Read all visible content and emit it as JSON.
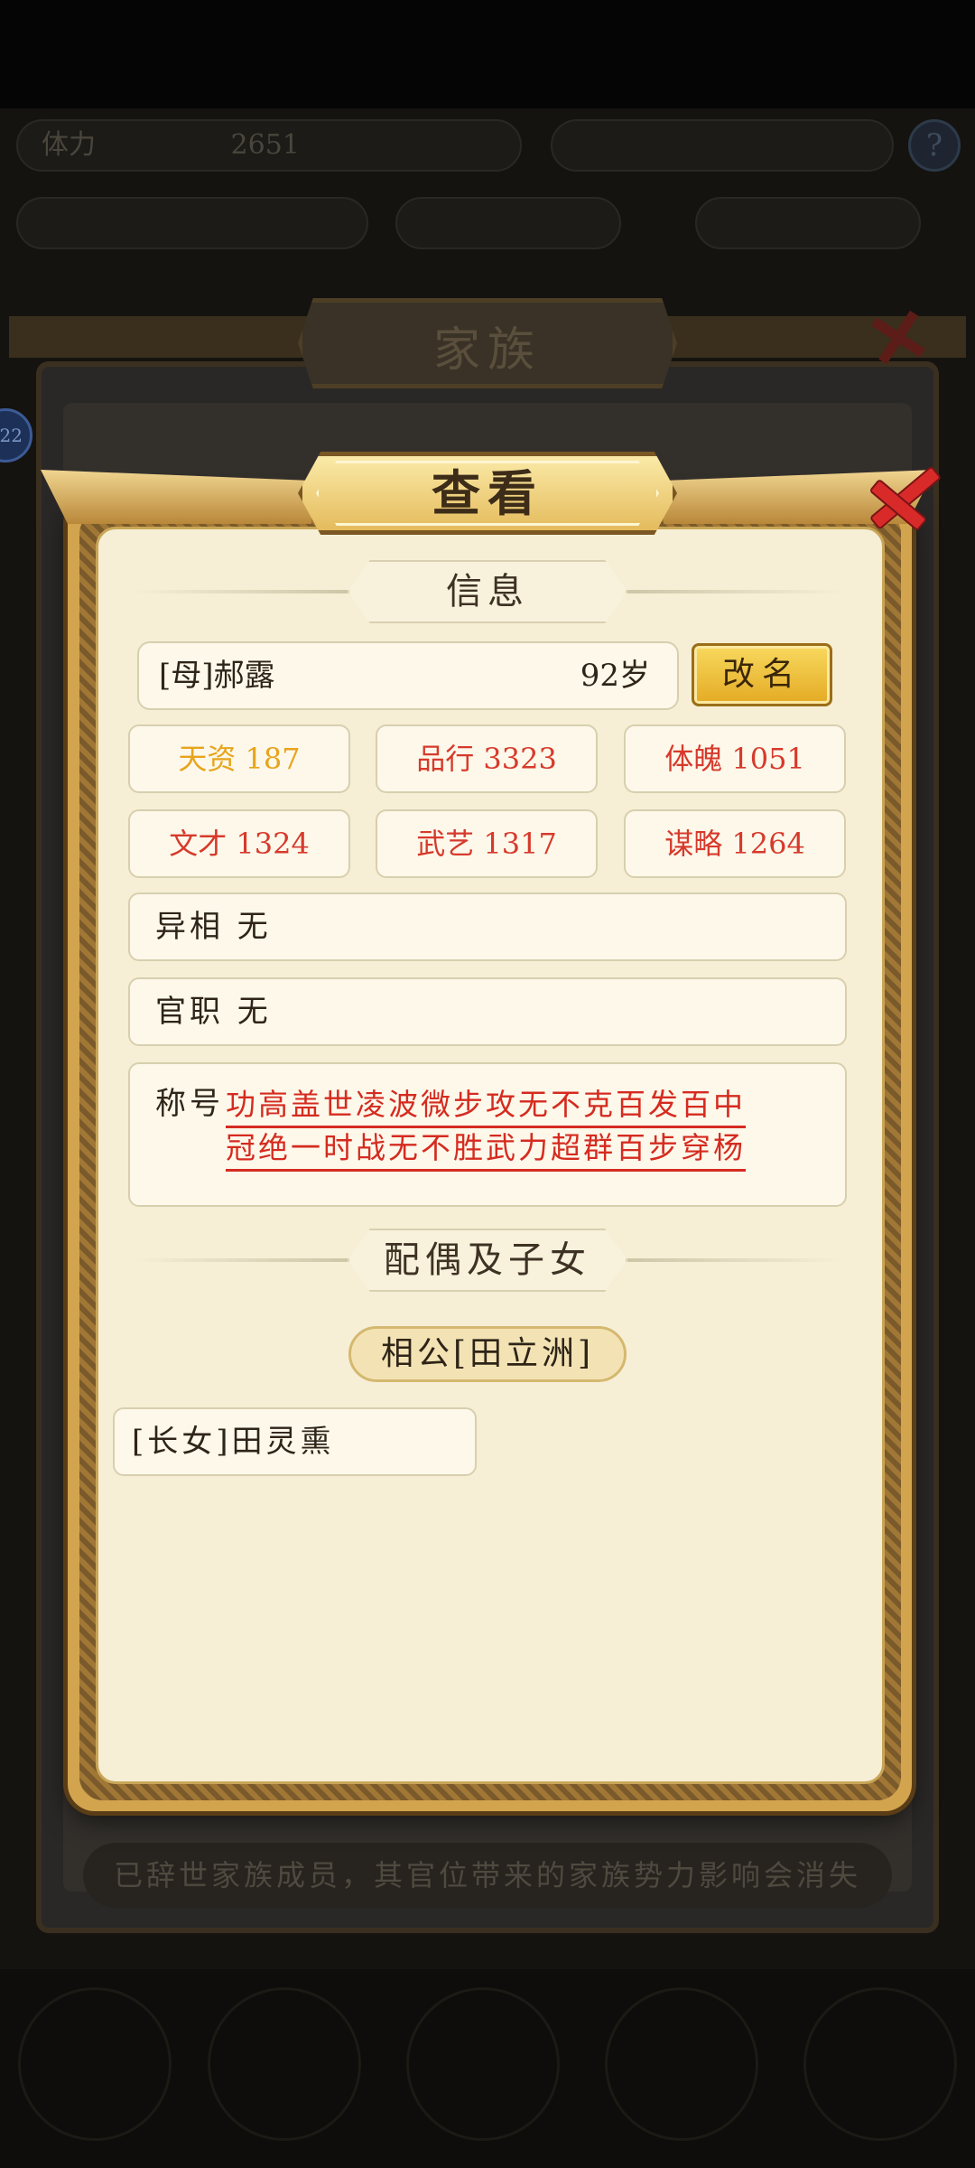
{
  "background": {
    "resources": [
      "体力",
      "2651",
      "",
      "",
      ""
    ],
    "family_panel_title": "家族",
    "footer_note": "已辞世家族成员，其官位带来的家族势力影响会消失",
    "level_badge": "22",
    "help_icon": "question-icon"
  },
  "dialog": {
    "title": "查看",
    "info_header": "信息",
    "name": "[母]郝露",
    "age": "92岁",
    "rename_button": "改名",
    "stats": [
      {
        "label": "天资 187",
        "color": "gold"
      },
      {
        "label": "品行 3323",
        "color": "red"
      },
      {
        "label": "体魄 1051",
        "color": "red"
      },
      {
        "label": "文才 1324",
        "color": "red"
      },
      {
        "label": "武艺 1317",
        "color": "red"
      },
      {
        "label": "谋略 1264",
        "color": "red"
      }
    ],
    "appearance": "异相 无",
    "official_post": "官职 无",
    "honorific_label": "称号",
    "honorifics_line1": "功高盖世凌波微步攻无不克百发百中",
    "honorifics_line2": "冠绝一时战无不胜武力超群百步穿杨",
    "family_header": "配偶及子女",
    "spouse": "相公[田立洲]",
    "children": [
      "[长女]田灵熏"
    ]
  },
  "colors": {
    "accent_gold": "#e8a41c",
    "accent_red": "#d63a2c",
    "panel_bg": "#f6efd6"
  }
}
